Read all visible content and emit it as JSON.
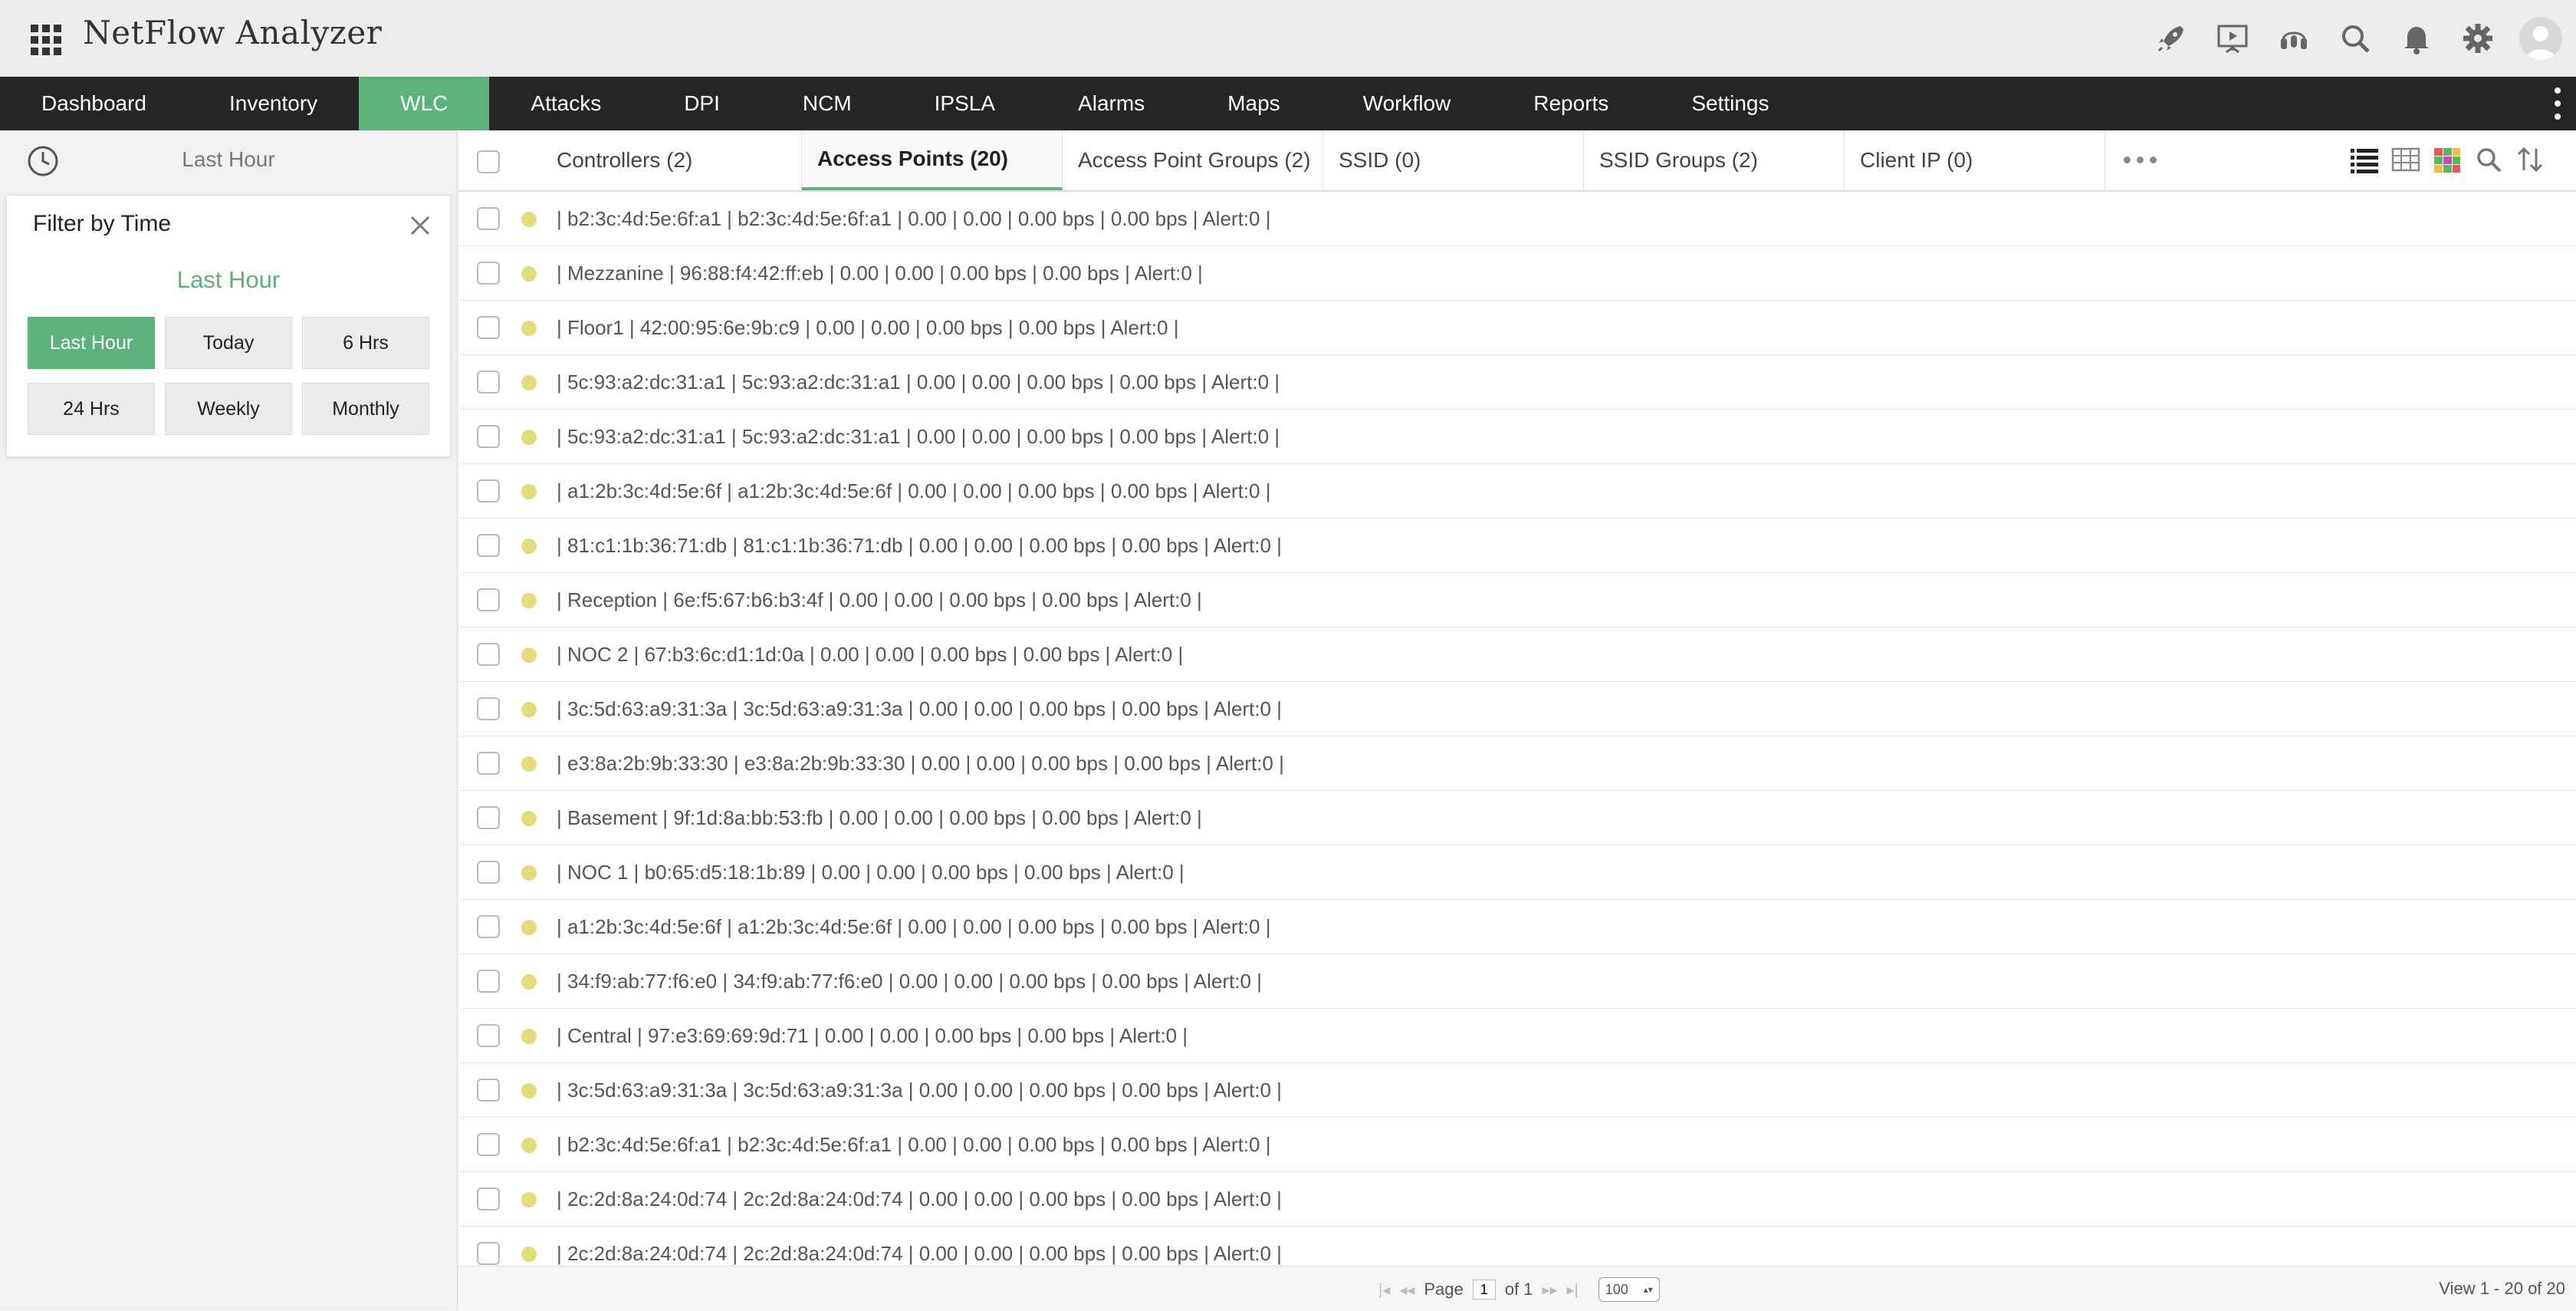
{
  "header": {
    "title": "NetFlow Analyzer",
    "icons": [
      "rocket-icon",
      "presentation-icon",
      "support-icon",
      "search-icon",
      "bell-icon",
      "gear-icon",
      "user-avatar"
    ]
  },
  "nav": {
    "items": [
      "Dashboard",
      "Inventory",
      "WLC",
      "Attacks",
      "DPI",
      "NCM",
      "IPSLA",
      "Alarms",
      "Maps",
      "Workflow",
      "Reports",
      "Settings"
    ],
    "active": "WLC"
  },
  "sidebar": {
    "time_label": "Last Hour",
    "filter": {
      "title": "Filter by Time",
      "selected": "Last Hour",
      "buttons": [
        "Last Hour",
        "Today",
        "6 Hrs",
        "24 Hrs",
        "Weekly",
        "Monthly"
      ]
    }
  },
  "tabs": {
    "items": [
      "Controllers (2)",
      "Access Points (20)",
      "Access Point Groups (2)",
      "SSID (0)",
      "SSID Groups (2)",
      "Client IP (0)"
    ],
    "active": "Access Points (20)"
  },
  "colors": {
    "accent": "#5bb27b",
    "nav_bg": "#252525",
    "status_dot": "#e2dc7a"
  },
  "rows": [
    "| b2:3c:4d:5e:6f:a1 | b2:3c:4d:5e:6f:a1 | 0.00 | 0.00 | 0.00 bps | 0.00 bps | Alert:0 |",
    "| Mezzanine | 96:88:f4:42:ff:eb | 0.00 | 0.00 | 0.00 bps | 0.00 bps | Alert:0 |",
    "| Floor1 | 42:00:95:6e:9b:c9 | 0.00 | 0.00 | 0.00 bps | 0.00 bps | Alert:0 |",
    "| 5c:93:a2:dc:31:a1 | 5c:93:a2:dc:31:a1 | 0.00 | 0.00 | 0.00 bps | 0.00 bps | Alert:0 |",
    "| 5c:93:a2:dc:31:a1 | 5c:93:a2:dc:31:a1 | 0.00 | 0.00 | 0.00 bps | 0.00 bps | Alert:0 |",
    "| a1:2b:3c:4d:5e:6f | a1:2b:3c:4d:5e:6f | 0.00 | 0.00 | 0.00 bps | 0.00 bps | Alert:0 |",
    "| 81:c1:1b:36:71:db | 81:c1:1b:36:71:db | 0.00 | 0.00 | 0.00 bps | 0.00 bps | Alert:0 |",
    "| Reception | 6e:f5:67:b6:b3:4f | 0.00 | 0.00 | 0.00 bps | 0.00 bps | Alert:0 |",
    "| NOC 2 | 67:b3:6c:d1:1d:0a | 0.00 | 0.00 | 0.00 bps | 0.00 bps | Alert:0 |",
    "| 3c:5d:63:a9:31:3a | 3c:5d:63:a9:31:3a | 0.00 | 0.00 | 0.00 bps | 0.00 bps | Alert:0 |",
    "| e3:8a:2b:9b:33:30 | e3:8a:2b:9b:33:30 | 0.00 | 0.00 | 0.00 bps | 0.00 bps | Alert:0 |",
    "| Basement | 9f:1d:8a:bb:53:fb | 0.00 | 0.00 | 0.00 bps | 0.00 bps | Alert:0 |",
    "| NOC 1 | b0:65:d5:18:1b:89 | 0.00 | 0.00 | 0.00 bps | 0.00 bps | Alert:0 |",
    "| a1:2b:3c:4d:5e:6f | a1:2b:3c:4d:5e:6f | 0.00 | 0.00 | 0.00 bps | 0.00 bps | Alert:0 |",
    "| 34:f9:ab:77:f6:e0 | 34:f9:ab:77:f6:e0 | 0.00 | 0.00 | 0.00 bps | 0.00 bps | Alert:0 |",
    "| Central | 97:e3:69:69:9d:71 | 0.00 | 0.00 | 0.00 bps | 0.00 bps | Alert:0 |",
    "| 3c:5d:63:a9:31:3a | 3c:5d:63:a9:31:3a | 0.00 | 0.00 | 0.00 bps | 0.00 bps | Alert:0 |",
    "| b2:3c:4d:5e:6f:a1 | b2:3c:4d:5e:6f:a1 | 0.00 | 0.00 | 0.00 bps | 0.00 bps | Alert:0 |",
    "| 2c:2d:8a:24:0d:74 | 2c:2d:8a:24:0d:74 | 0.00 | 0.00 | 0.00 bps | 0.00 bps | Alert:0 |",
    "| 2c:2d:8a:24:0d:74 | 2c:2d:8a:24:0d:74 | 0.00 | 0.00 | 0.00 bps | 0.00 bps | Alert:0 |"
  ],
  "footer": {
    "page_label": "Page",
    "page_value": "1",
    "of_label": "of 1",
    "per_page": "100",
    "view_count": "View 1 - 20 of 20"
  }
}
